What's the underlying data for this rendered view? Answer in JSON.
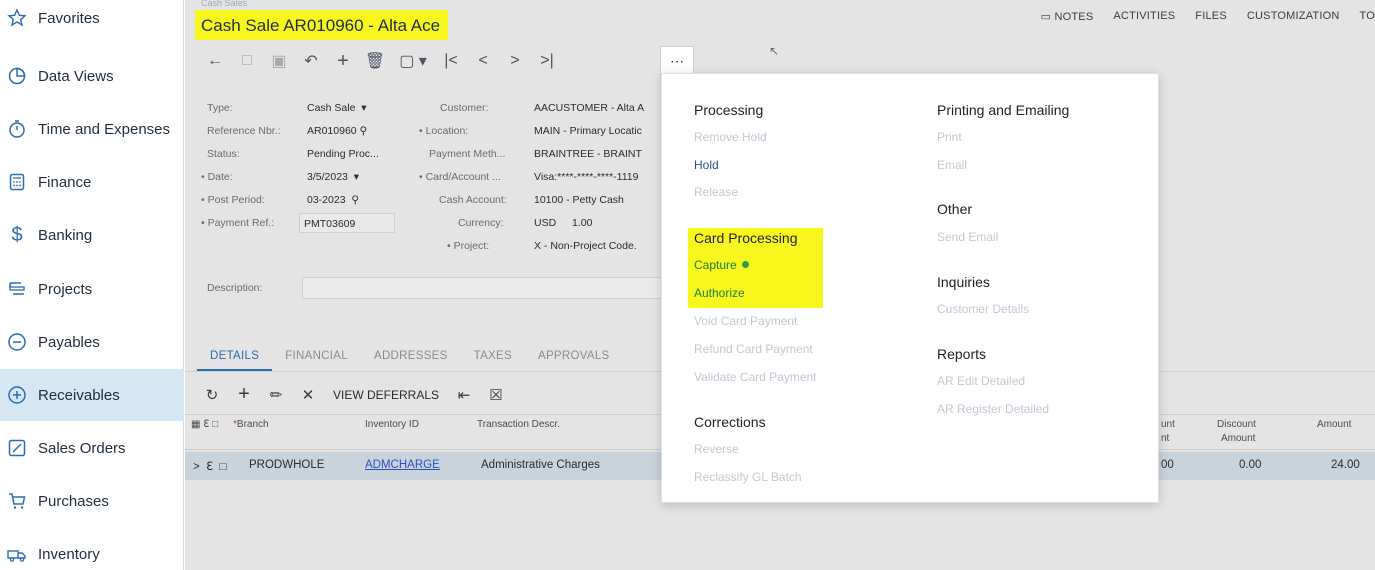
{
  "sidebar": {
    "items": [
      {
        "label": "Favorites",
        "icon": "star-icon"
      },
      {
        "label": "Data Views",
        "icon": "pie-chart-icon"
      },
      {
        "label": "Time and Expenses",
        "icon": "stopwatch-icon"
      },
      {
        "label": "Finance",
        "icon": "calculator-icon"
      },
      {
        "label": "Banking",
        "icon": "dollar-icon"
      },
      {
        "label": "Projects",
        "icon": "projects-icon"
      },
      {
        "label": "Payables",
        "icon": "minus-circle-icon"
      },
      {
        "label": "Receivables",
        "icon": "plus-circle-icon"
      },
      {
        "label": "Sales Orders",
        "icon": "pencil-icon"
      },
      {
        "label": "Purchases",
        "icon": "cart-icon"
      },
      {
        "label": "Inventory",
        "icon": "truck-icon"
      }
    ],
    "active": "Receivables"
  },
  "header": {
    "breadcrumb": "Cash Sales",
    "title": "Cash Sale AR010960 - Alta Ace",
    "links": [
      "NOTES",
      "ACTIVITIES",
      "FILES",
      "CUSTOMIZATION",
      "TO"
    ]
  },
  "form": {
    "type_label": "Type:",
    "type_value": "Cash Sale",
    "ref_label": "Reference Nbr.:",
    "ref_value": "AR010960",
    "status_label": "Status:",
    "status_value": "Pending Proc...",
    "date_label": "Date:",
    "date_value": "3/5/2023",
    "period_label": "Post Period:",
    "period_value": "03-2023",
    "payref_label": "Payment Ref.:",
    "payref_value": "PMT03609",
    "customer_label": "Customer:",
    "customer_value": "AACUSTOMER - Alta A",
    "location_label": "Location:",
    "location_value": "MAIN - Primary Locatic",
    "paymeth_label": "Payment Meth...",
    "paymeth_value": "BRAINTREE - BRAINT",
    "card_label": "Card/Account ...",
    "card_value": "Visa:****-****-****-1119",
    "cashacct_label": "Cash Account:",
    "cashacct_value": "10100 - Petty Cash",
    "currency_label": "Currency:",
    "currency_value": "USD",
    "rate_value": "1.00",
    "project_label": "Project:",
    "project_value": "X - Non-Project Code.",
    "description_label": "Description:"
  },
  "tabs": [
    "DETAILS",
    "FINANCIAL",
    "ADDRESSES",
    "TAXES",
    "APPROVALS"
  ],
  "grid": {
    "view_deferrals": "VIEW DEFERRALS",
    "headers": {
      "branch": "Branch",
      "inventory": "Inventory ID",
      "descr": "Transaction Descr.",
      "amt_partial_1": "unt",
      "amt_partial_2": "nt",
      "discount_1": "Discount",
      "discount_2": "Amount",
      "amount": "Amount"
    },
    "row": {
      "branch": "PRODWHOLE",
      "inventory": "ADMCHARGE",
      "descr": "Administrative Charges",
      "partial": "00",
      "discount": "0.00",
      "amount": "24.00"
    }
  },
  "menu": {
    "processing": {
      "title": "Processing",
      "items": [
        "Remove Hold",
        "Hold",
        "Release"
      ]
    },
    "card_processing": {
      "title": "Card Processing",
      "items": [
        "Capture",
        "Authorize",
        "Void Card Payment",
        "Refund Card Payment",
        "Validate Card Payment"
      ]
    },
    "corrections": {
      "title": "Corrections",
      "items": [
        "Reverse",
        "Reclassify GL Batch"
      ]
    },
    "printing": {
      "title": "Printing and Emailing",
      "items": [
        "Print",
        "Email"
      ]
    },
    "other": {
      "title": "Other",
      "items": [
        "Send Email"
      ]
    },
    "inquiries": {
      "title": "Inquiries",
      "items": [
        "Customer Details"
      ]
    },
    "reports": {
      "title": "Reports",
      "items": [
        "AR Edit Detailed",
        "AR Register Detailed"
      ]
    }
  },
  "colors": {
    "highlight": "#f7f71e",
    "active_nav": "#d6e7f4",
    "link": "#1f4f8f",
    "disabled": "#c0c8d2"
  }
}
